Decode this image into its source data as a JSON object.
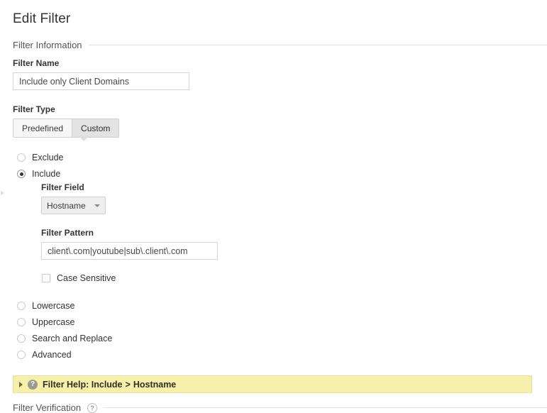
{
  "page": {
    "title": "Edit Filter"
  },
  "sections": {
    "filter_information": {
      "heading": "Filter Information"
    },
    "filter_verification": {
      "heading": "Filter Verification",
      "help_icon": "?"
    }
  },
  "filter_name": {
    "label": "Filter Name",
    "value": "Include only Client Domains",
    "placeholder": "Filter Name"
  },
  "filter_type": {
    "label": "Filter Type",
    "options": [
      {
        "label": "Predefined",
        "selected": false
      },
      {
        "label": "Custom",
        "selected": true
      }
    ],
    "predefined_label": "Predefined",
    "custom_label": "Custom",
    "selected": "Custom"
  },
  "custom_filter": {
    "primary_radios": [
      {
        "label": "Exclude",
        "selected": false
      },
      {
        "label": "Include",
        "selected": true
      }
    ],
    "exclude_label": "Exclude",
    "include_label": "Include",
    "filter_field": {
      "label": "Filter Field",
      "value": "Hostname"
    },
    "filter_pattern": {
      "label": "Filter Pattern",
      "value": "client\\.com|youtube|sub\\.client\\.com",
      "placeholder": "Filter Pattern"
    },
    "case_sensitive": {
      "label": "Case Sensitive",
      "checked": false
    },
    "secondary_radios": [
      {
        "label": "Lowercase",
        "selected": false
      },
      {
        "label": "Uppercase",
        "selected": false
      },
      {
        "label": "Search and Replace",
        "selected": false
      },
      {
        "label": "Advanced",
        "selected": false
      }
    ],
    "lowercase_label": "Lowercase",
    "uppercase_label": "Uppercase",
    "search_replace_label": "Search and Replace",
    "advanced_label": "Advanced"
  },
  "filter_help": {
    "icon": "?",
    "prefix": "Filter Help: Include",
    "separator": ">",
    "target": "Hostname",
    "expanded": false
  },
  "colors": {
    "help_bar_background": "#f7f0ac",
    "help_bar_border": "#e8e0a0",
    "selected_segment": "#e3e3e3",
    "input_border": "#d5d5d5",
    "text": "#333333"
  }
}
